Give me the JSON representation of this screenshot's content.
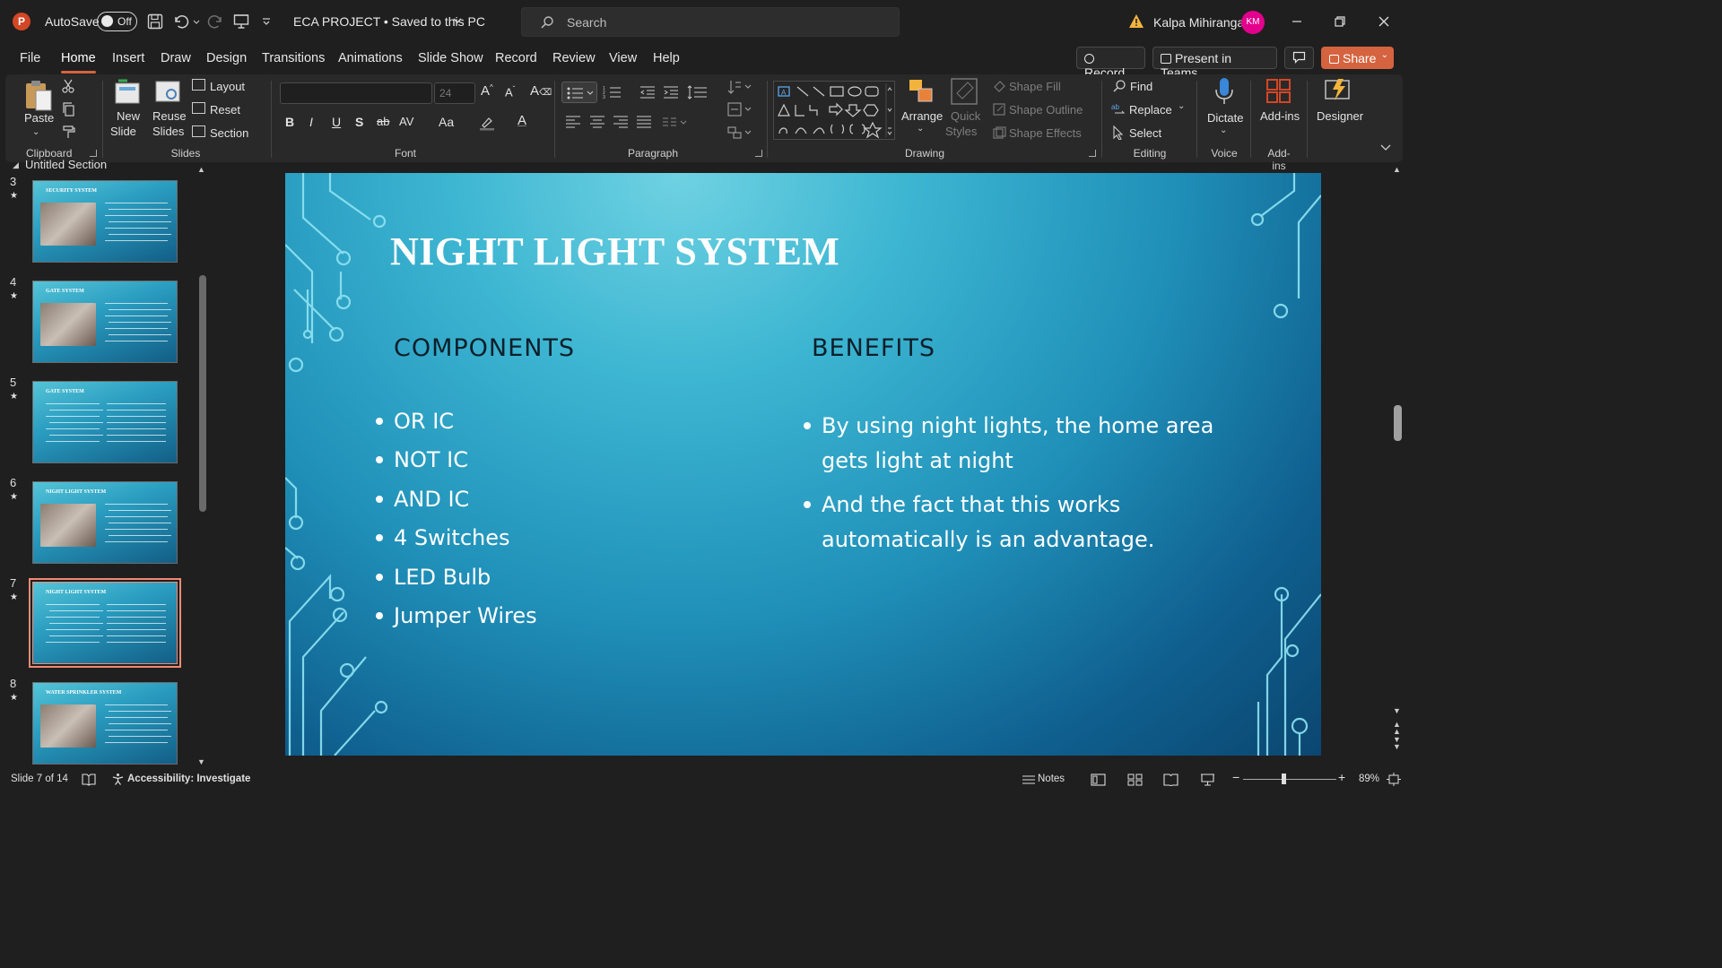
{
  "titlebar": {
    "autosave_label": "AutoSave",
    "autosave_state": "Off",
    "doc_title": "ECA PROJECT • Saved to this PC",
    "search_placeholder": "Search",
    "user_name": "Kalpa Mihiranga",
    "user_initials": "KM"
  },
  "menu": {
    "tabs": [
      "File",
      "Home",
      "Insert",
      "Draw",
      "Design",
      "Transitions",
      "Animations",
      "Slide Show",
      "Record",
      "Review",
      "View",
      "Help"
    ],
    "active": "Home",
    "record_btn": "Record",
    "present_btn": "Present in Teams",
    "share_btn": "Share"
  },
  "ribbon": {
    "clipboard": {
      "paste": "Paste",
      "group": "Clipboard"
    },
    "slides": {
      "new_slide_1": "New",
      "new_slide_2": "Slide",
      "reuse_1": "Reuse",
      "reuse_2": "Slides",
      "layout": "Layout",
      "reset": "Reset",
      "section": "Section",
      "group": "Slides"
    },
    "font": {
      "font_name": "",
      "font_size": "24",
      "group": "Font",
      "bold": "B",
      "italic": "I",
      "underline": "U",
      "shadow": "S",
      "strike": "ab",
      "spacing": "AV",
      "case": "Aa",
      "color": "A"
    },
    "paragraph": {
      "group": "Paragraph"
    },
    "drawing": {
      "arrange": "Arrange",
      "quick_1": "Quick",
      "quick_2": "Styles",
      "shape_fill": "Shape Fill",
      "shape_outline": "Shape Outline",
      "shape_effects": "Shape Effects",
      "group": "Drawing"
    },
    "editing": {
      "find": "Find",
      "replace": "Replace",
      "select": "Select",
      "group": "Editing"
    },
    "voice": {
      "dictate": "Dictate",
      "group": "Voice"
    },
    "addins": {
      "addins": "Add-ins",
      "group": "Add-ins"
    },
    "designer": {
      "designer": "Designer"
    }
  },
  "thumbnails": {
    "section_label": "Untitled Section",
    "slides": [
      {
        "num": "3",
        "title": "SECURITY SYSTEM"
      },
      {
        "num": "4",
        "title": "GATE SYSTEM"
      },
      {
        "num": "5",
        "title": "GATE SYSTEM"
      },
      {
        "num": "6",
        "title": "NIGHT LIGHT SYSTEM"
      },
      {
        "num": "7",
        "title": "NIGHT LIGHT SYSTEM"
      },
      {
        "num": "8",
        "title": "WATER SPRINKLER SYSTEM"
      }
    ]
  },
  "slide": {
    "title": "NIGHT LIGHT SYSTEM",
    "components_heading": "COMPONENTS",
    "benefits_heading": "BENEFITS",
    "components": [
      "OR IC",
      "NOT IC",
      "AND IC",
      "4 Switches",
      "LED Bulb",
      "Jumper Wires"
    ],
    "benefits": [
      [
        "By using night lights, the home area",
        "gets light at night"
      ],
      [
        "And the fact that this works",
        "automatically is an advantage."
      ]
    ]
  },
  "status": {
    "slide_counter": "Slide 7 of 14",
    "accessibility": "Accessibility: Investigate",
    "notes": "Notes",
    "zoom": "89%"
  },
  "colors": {
    "accent": "#d5633f",
    "selected_thumb": "#f08a74",
    "slide_mid": "#1f8fb8"
  }
}
